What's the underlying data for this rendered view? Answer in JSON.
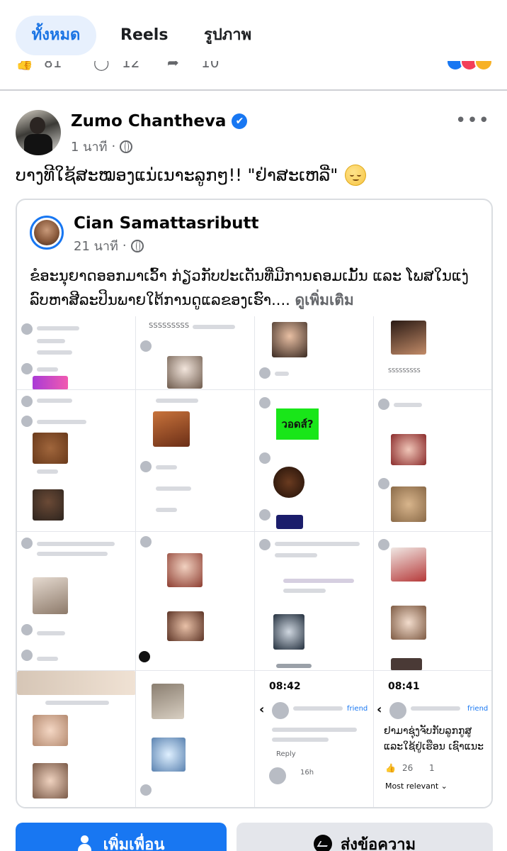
{
  "tabs": {
    "all": "ทั้งหมด",
    "reels": "Reels",
    "photos": "รูปภาพ"
  },
  "prev_post": {
    "likes": "81",
    "comments": "12",
    "shares": "10"
  },
  "post": {
    "author": "Zumo Chantheva",
    "verified_mark": "✔",
    "time": "1 นาที",
    "more": "•••",
    "caption": "ບາງທີໃຊ້ສະໝອງແນ່ເນາະລູກໆ!! \"ຢ່າສະເຫລີ່\""
  },
  "shared": {
    "author": "Cian Samattasributt",
    "time": "21 นาที",
    "text": "ຂໍອະນຸຍາດອອກມາເວົ້າ ກ່ຽວກັບປະເດັນທີ່ມີການຄອມເມັ້ນ ແລະ ໂພສໃນແງ່ລົບຫາສີລະປິນພາຍໃຕ້ການດູແລຂອງເຮົາ....",
    "see_more": "ดูเพิ่มเติม"
  },
  "collage": {
    "tile_a_text": "SSSSSSSSS",
    "tile_b_text": "วอดส์?",
    "tile_c_time1": "08:42",
    "tile_c_time2": "08:41",
    "tile_c_friend": "friend",
    "tile_c_reply": "Reply",
    "tile_c_hand": "ຢາມາຊຸ່ງຈັບກັບລູກກູສູ ແລະໃຊ້ຢູ່ເຮືອນ ເຊົາແນະ",
    "tile_c_likes": "26",
    "tile_c_shares": "1",
    "tile_c_relevant": "Most relevant ⌄",
    "tile_c_16h": "16h"
  },
  "buttons": {
    "add_friend": "เพิ่มเพื่อน",
    "message": "ส่งข้อความ"
  },
  "colors": {
    "brand": "#1877f2",
    "tab_active_bg": "#e7f0fd",
    "secondary_btn": "#e4e6eb"
  }
}
